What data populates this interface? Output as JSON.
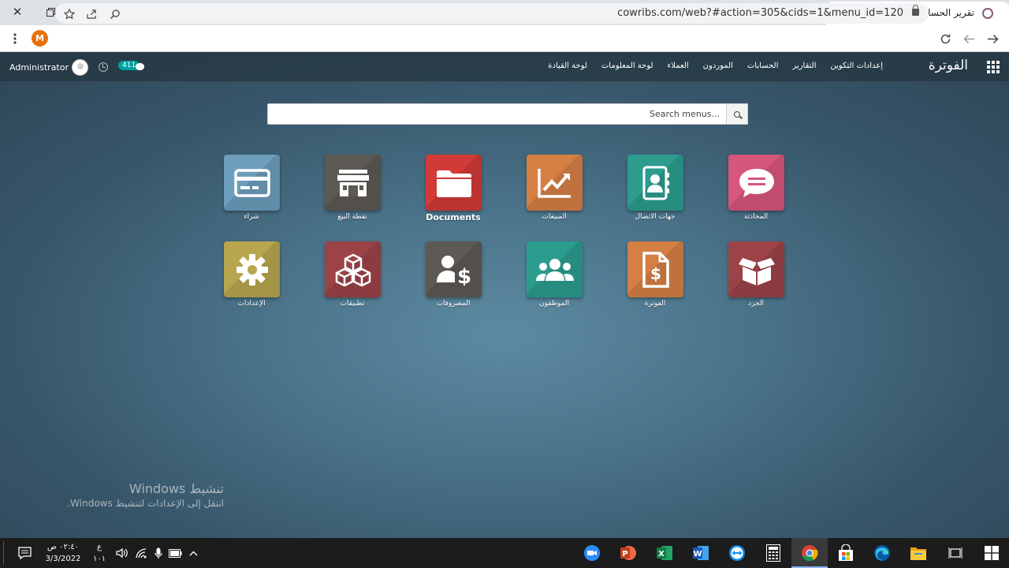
{
  "browser": {
    "tab_title": "تقرير الحساب - Odoo",
    "url": "cowribs.com/web?#action=305&cids=1&menu_id=120",
    "profile_initial": "M"
  },
  "odoo": {
    "brand": "الفوترة",
    "menu": [
      "لوحة القيادة",
      "لوحة المعلومات",
      "العملاء",
      "الموردون",
      "الحسابات",
      "التقارير",
      "إعدادات التكوين"
    ],
    "user_name": "Administrator",
    "message_count": "411",
    "search_placeholder": "...Search menus",
    "apps": [
      {
        "label": "المحادثة",
        "color": "#d6567c",
        "icon": "chat-icon"
      },
      {
        "label": "جهات الاتصال",
        "color": "#2c9c8f",
        "icon": "contacts-icon"
      },
      {
        "label": "المبيعات",
        "color": "#d57f44",
        "icon": "sales-chart-icon"
      },
      {
        "label": "Documents",
        "color": "#d13a37",
        "icon": "folder-icon"
      },
      {
        "label": "نقطة البيع",
        "color": "#5d5a55",
        "icon": "shop-icon"
      },
      {
        "label": "شراء",
        "color": "#6d9ebb",
        "icon": "credit-card-icon"
      },
      {
        "label": "الجرد",
        "color": "#9c4348",
        "icon": "box-icon"
      },
      {
        "label": "الفوترة",
        "color": "#d57f44",
        "icon": "invoice-icon"
      },
      {
        "label": "الموظفون",
        "color": "#2c9c8f",
        "icon": "employees-icon"
      },
      {
        "label": "المصروفات",
        "color": "#5d5a55",
        "icon": "expenses-icon"
      },
      {
        "label": "تطبيقات",
        "color": "#9c4348",
        "icon": "cubes-icon"
      },
      {
        "label": "الإعدادات",
        "color": "#b7a64f",
        "icon": "gear-icon"
      }
    ]
  },
  "watermark": {
    "title": "تنشيط Windows",
    "subtitle": "انتقل إلى الإعدادات لتنشيط Windows."
  },
  "taskbar": {
    "time": "٠٢:٤٠ ص",
    "date": "3/3/2022",
    "lang_top": "ع",
    "lang_bottom": "١٠١"
  }
}
